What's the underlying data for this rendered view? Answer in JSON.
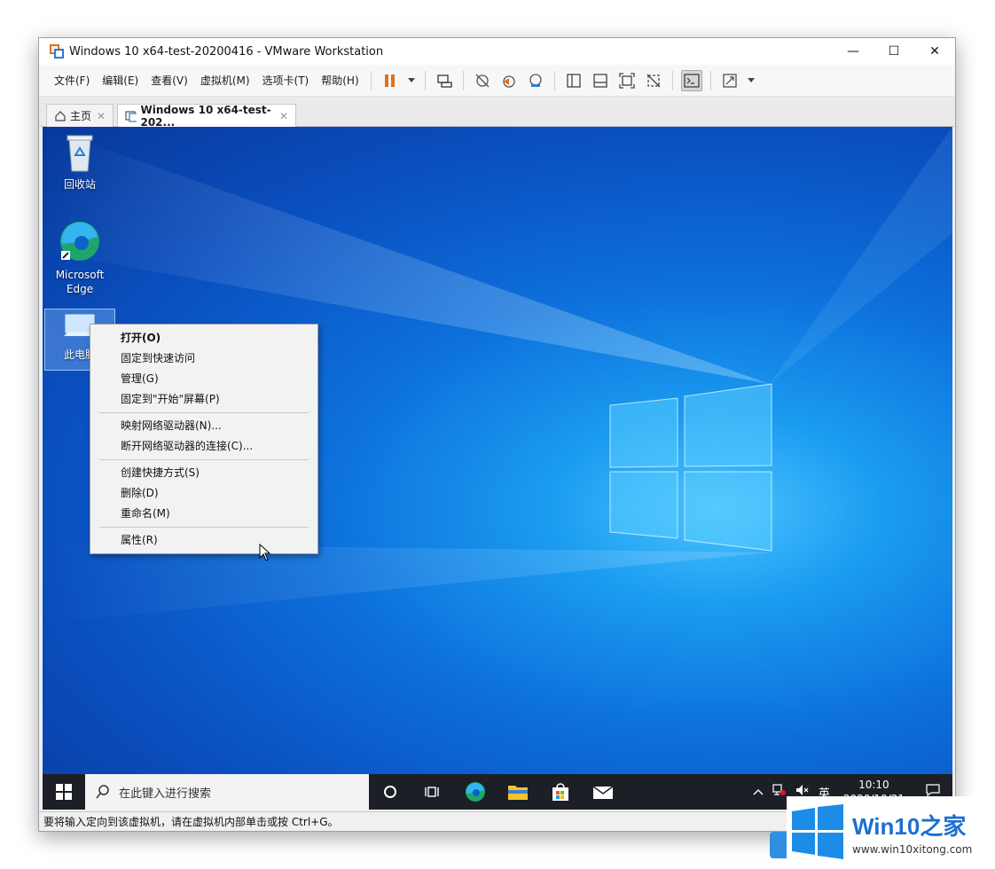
{
  "window": {
    "title": "Windows 10 x64-test-20200416 - VMware Workstation",
    "minimize": "—",
    "maximize": "☐",
    "close": "✕"
  },
  "menubar": {
    "items": [
      "文件(F)",
      "编辑(E)",
      "查看(V)",
      "虚拟机(M)",
      "选项卡(T)",
      "帮助(H)"
    ]
  },
  "tabs": [
    {
      "label": "主页",
      "close": "✕"
    },
    {
      "label": "Windows 10 x64-test-202...",
      "close": "✕"
    }
  ],
  "desktop": {
    "icons": [
      {
        "label": "回收站"
      },
      {
        "label": "Microsoft Edge"
      },
      {
        "label": "此电脑"
      }
    ]
  },
  "context_menu": {
    "groups": [
      [
        "打开(O)",
        "固定到快速访问",
        "管理(G)",
        "固定到\"开始\"屏幕(P)"
      ],
      [
        "映射网络驱动器(N)...",
        "断开网络驱动器的连接(C)..."
      ],
      [
        "创建快捷方式(S)",
        "删除(D)",
        "重命名(M)"
      ],
      [
        "属性(R)"
      ]
    ]
  },
  "taskbar": {
    "search_placeholder": "在此键入进行搜索",
    "ime": "英",
    "time": "10:10",
    "date": "2020/10/21"
  },
  "statusbar": {
    "text": "要将输入定向到该虚拟机，请在虚拟机内部单击或按 Ctrl+G。"
  },
  "watermark": {
    "brand": "Win10",
    "brand_suffix": "之家",
    "url": "www.win10xitong.com"
  },
  "colors": {
    "desktop_blue": "#0a5fd0",
    "taskbar": "#1c1f26",
    "pause_orange": "#e0701b",
    "brand_blue": "#1d6fd1"
  }
}
